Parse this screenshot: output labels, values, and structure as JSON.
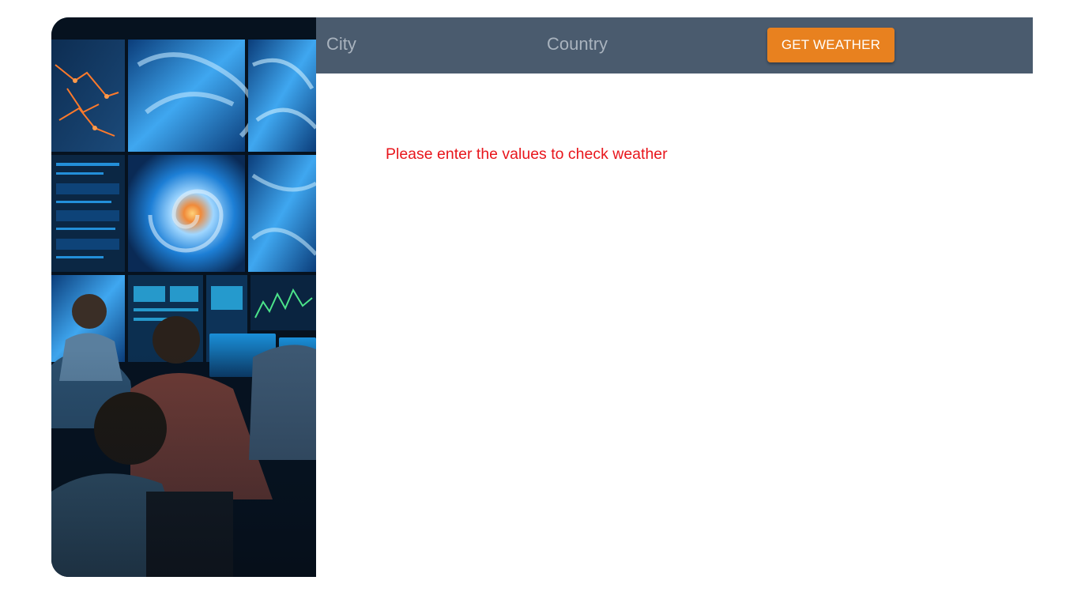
{
  "form": {
    "city_placeholder": "City",
    "country_placeholder": "Country",
    "city_value": "",
    "country_value": "",
    "submit_label": "GET WEATHER"
  },
  "status": {
    "message": "Please enter the values to check weather"
  },
  "hero": {
    "description_icon": "weather-control-room-image"
  },
  "colors": {
    "bar": "#4a5b6e",
    "button": "#e8811f",
    "message": "#e8161c"
  }
}
